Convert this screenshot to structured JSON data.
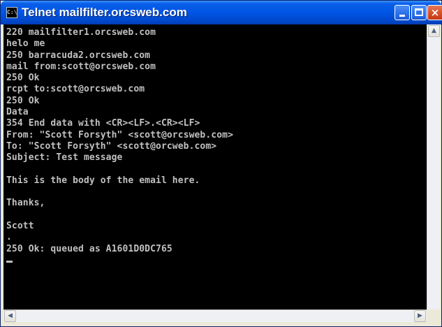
{
  "window": {
    "title": "Telnet mailfilter.orcsweb.com",
    "system_icon": "console-icon",
    "system_icon_glyph": "C:\\",
    "controls": {
      "minimize_icon": "minimize-icon",
      "maximize_icon": "maximize-icon",
      "close_glyph": "×"
    }
  },
  "console": {
    "lines": [
      "220 mailfilter1.orcsweb.com",
      "helo me",
      "250 barracuda2.orcsweb.com",
      "mail from:scott@orcsweb.com",
      "250 Ok",
      "rcpt to:scott@orcsweb.com",
      "250 Ok",
      "Data",
      "354 End data with <CR><LF>.<CR><LF>",
      "From: \"Scott Forsyth\" <scott@orcsweb.com>",
      "To: \"Scott Forsyth\" <scott@orcweb.com>",
      "Subject: Test message",
      "",
      "This is the body of the email here.",
      "",
      "Thanks,",
      "",
      "Scott",
      ".",
      "250 Ok: queued as A1601D0DC765",
      ""
    ]
  },
  "scrollbars": {
    "up_glyph": "▲",
    "down_glyph": "▼",
    "left_glyph": "◀",
    "right_glyph": "▶"
  },
  "colors": {
    "console_bg": "#000000",
    "console_fg": "#c0c0c0",
    "titlebar": "#0055e5"
  }
}
